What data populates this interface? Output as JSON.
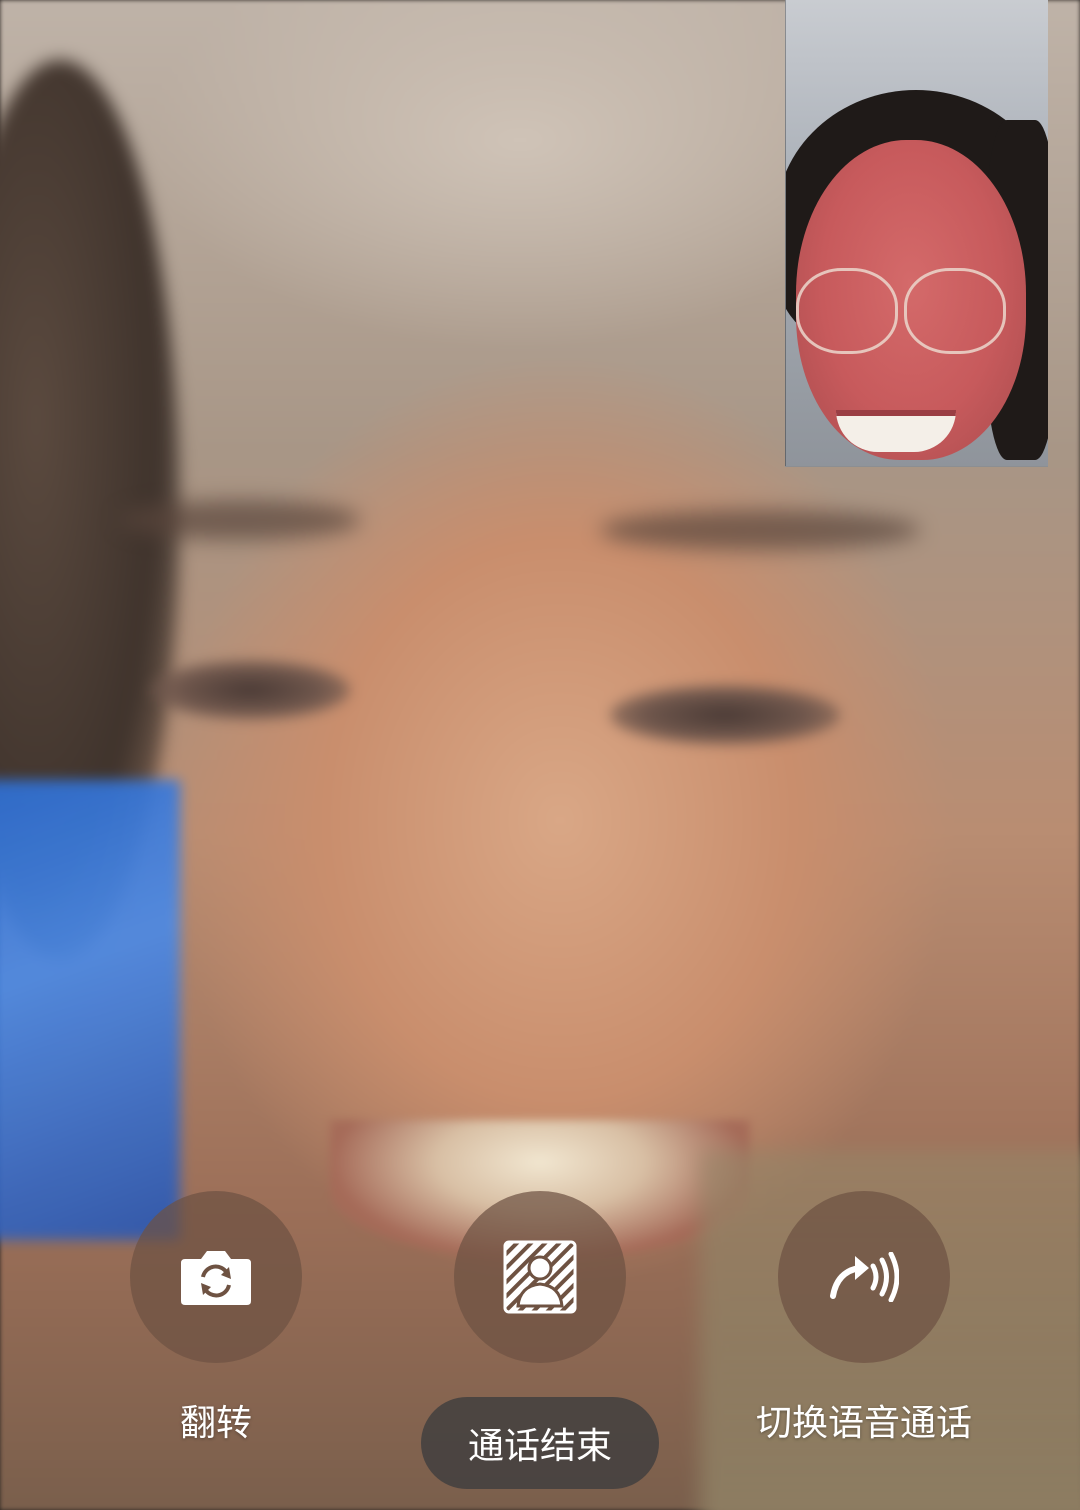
{
  "call": {
    "controls": {
      "flip_label": "翻转",
      "end_label": "通话结束",
      "switch_voice_label": "切换语音通话"
    },
    "icons": {
      "flip": "camera-flip-icon",
      "blur_background": "portrait-mask-icon",
      "switch_voice": "voice-call-icon"
    },
    "colors": {
      "control_bg": "#6e5242",
      "end_pill_bg": "#3c3c3e",
      "label": "#ffffff"
    }
  }
}
